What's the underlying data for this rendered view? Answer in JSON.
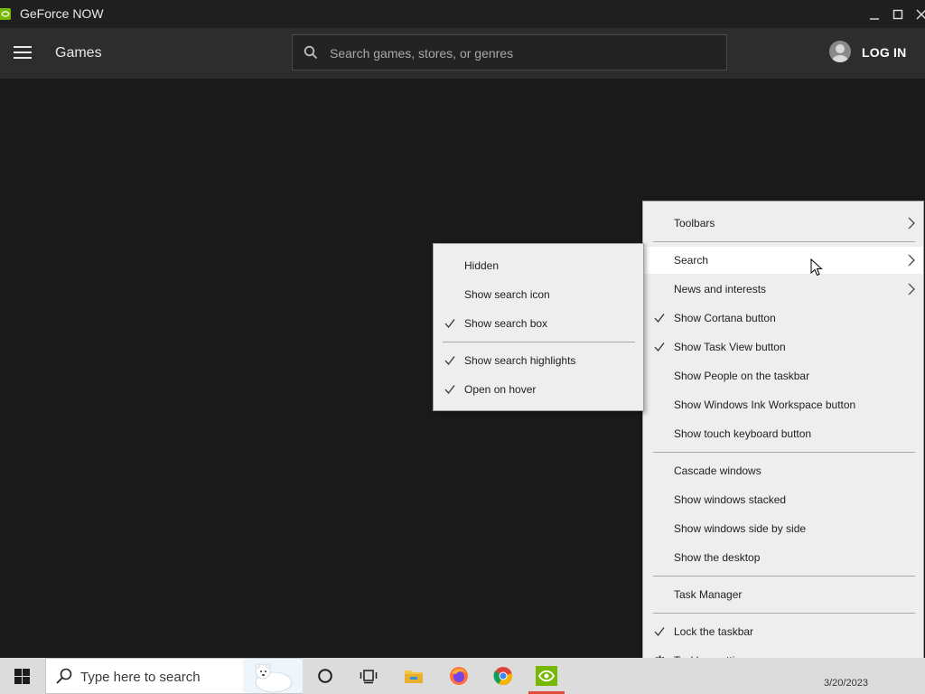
{
  "window": {
    "title": "GeForce NOW",
    "accent": "#76b900"
  },
  "header": {
    "section_title": "Games",
    "search_placeholder": "Search games, stores, or genres",
    "login_label": "LOG IN"
  },
  "context_menu": {
    "items": [
      {
        "label": "Toolbars",
        "checked": false,
        "submenu": true
      },
      {
        "label": "Search",
        "checked": false,
        "submenu": true,
        "highlighted": true
      },
      {
        "label": "News and interests",
        "checked": false,
        "submenu": true
      },
      {
        "label": "Show Cortana button",
        "checked": true
      },
      {
        "label": "Show Task View button",
        "checked": true
      },
      {
        "label": "Show People on the taskbar",
        "checked": false
      },
      {
        "label": "Show Windows Ink Workspace button",
        "checked": false
      },
      {
        "label": "Show touch keyboard button",
        "checked": false
      },
      {
        "label": "Cascade windows",
        "checked": false
      },
      {
        "label": "Show windows stacked",
        "checked": false
      },
      {
        "label": "Show windows side by side",
        "checked": false
      },
      {
        "label": "Show the desktop",
        "checked": false
      },
      {
        "label": "Task Manager",
        "checked": false
      },
      {
        "label": "Lock the taskbar",
        "checked": true
      },
      {
        "label": "Taskbar settings",
        "icon": "gear-icon"
      }
    ]
  },
  "search_submenu": {
    "items": [
      {
        "label": "Hidden",
        "checked": false
      },
      {
        "label": "Show search icon",
        "checked": false
      },
      {
        "label": "Show search box",
        "checked": true
      },
      {
        "label": "Show search highlights",
        "checked": true
      },
      {
        "label": "Open on hover",
        "checked": true
      }
    ]
  },
  "taskbar": {
    "search_placeholder": "Type here to search",
    "date": "3/20/2023",
    "pinned": [
      "cortana-icon",
      "task-view-icon",
      "file-explorer-icon",
      "firefox-icon",
      "chrome-icon",
      "geforce-now-icon"
    ],
    "active_indicator_color": "#e14b3b"
  }
}
